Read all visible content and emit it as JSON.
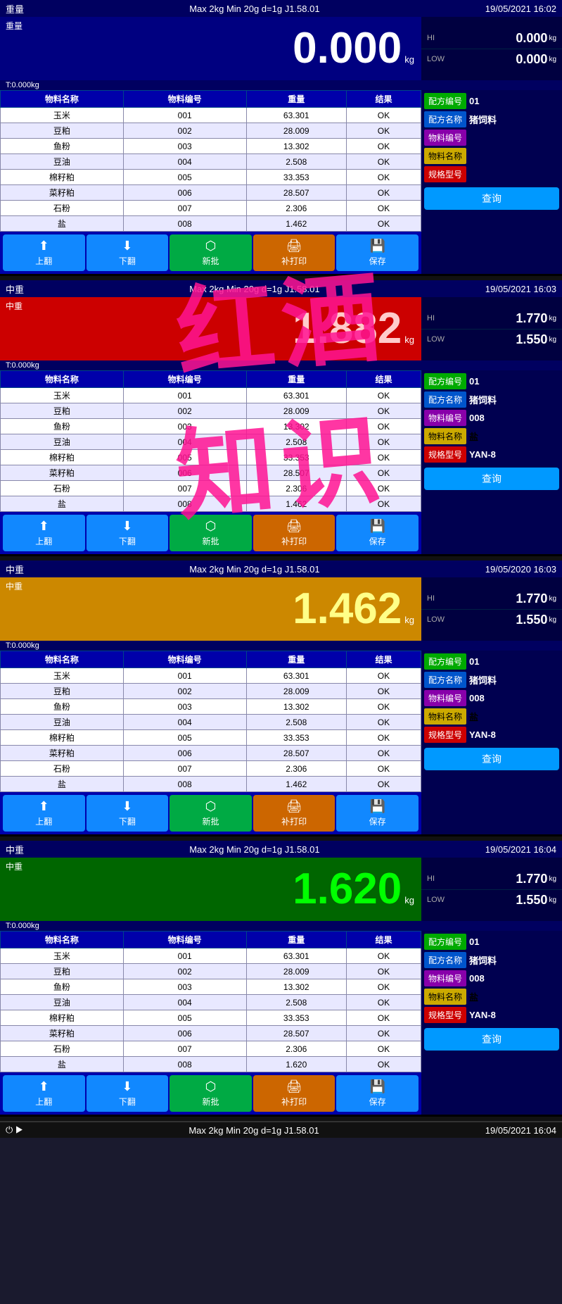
{
  "app": {
    "title": "红酒知识"
  },
  "panels": [
    {
      "id": "panel1",
      "topbar": {
        "left": "重量",
        "center": "Max 2kg  Min 20g  d=1g    J1.58.01",
        "right": "19/05/2021  16:02"
      },
      "weight": {
        "value": "0.000",
        "color": "white",
        "unit": "kg",
        "hi": "0.000",
        "lo": "0.000"
      },
      "sublabel": "T:0.000kg",
      "table": {
        "headers": [
          "物料名称",
          "物料编号",
          "重量",
          "结果"
        ],
        "rows": [
          [
            "玉米",
            "001",
            "63.301",
            "OK"
          ],
          [
            "豆粕",
            "002",
            "28.009",
            "OK"
          ],
          [
            "鱼粉",
            "003",
            "13.302",
            "OK"
          ],
          [
            "豆油",
            "004",
            "2.508",
            "OK"
          ],
          [
            "棉籽粕",
            "005",
            "33.353",
            "OK"
          ],
          [
            "菜籽粕",
            "006",
            "28.507",
            "OK"
          ],
          [
            "石粉",
            "007",
            "2.306",
            "OK"
          ],
          [
            "盐",
            "008",
            "1.462",
            "OK"
          ]
        ]
      },
      "info": {
        "formula_no_label": "配方编号",
        "formula_no_value": "01",
        "formula_name_label": "配方名称",
        "formula_name_value": "猪饲料",
        "material_no_label": "物料编号",
        "material_no_value": "",
        "material_name_label": "物料名称",
        "material_name_value": "",
        "spec_label": "规格型号",
        "spec_value": "",
        "query_btn": "查询"
      },
      "buttons": [
        "上翻",
        "下翻",
        "新批",
        "补打印",
        "保存"
      ]
    },
    {
      "id": "panel2",
      "topbar": {
        "left": "中重",
        "center": "Max 2kg  Min 20g  d=1g    J1.58.01",
        "right": "19/05/2021  16:03"
      },
      "weight": {
        "value": "1.882",
        "color": "red",
        "unit": "kg",
        "hi": "1.770",
        "lo": "1.550"
      },
      "sublabel": "T:0.000kg",
      "table": {
        "headers": [
          "物料名称",
          "物料编号",
          "重量",
          "结果"
        ],
        "rows": [
          [
            "玉米",
            "001",
            "63.301",
            "OK"
          ],
          [
            "豆粕",
            "002",
            "28.009",
            "OK"
          ],
          [
            "鱼粉",
            "003",
            "13.302",
            "OK"
          ],
          [
            "豆油",
            "004",
            "2.508",
            "OK"
          ],
          [
            "棉籽粕",
            "005",
            "33.353",
            "OK"
          ],
          [
            "菜籽粕",
            "006",
            "28.507",
            "OK"
          ],
          [
            "石粉",
            "007",
            "2.306",
            "OK"
          ],
          [
            "盐",
            "008",
            "1.462",
            "OK"
          ]
        ]
      },
      "info": {
        "formula_no_label": "配方编号",
        "formula_no_value": "01",
        "formula_name_label": "配方名称",
        "formula_name_value": "猪饲料",
        "material_no_label": "物料编号",
        "material_no_value": "008",
        "material_name_label": "物料名称",
        "material_name_value": "盐",
        "spec_label": "规格型号",
        "spec_value": "YAN-8",
        "query_btn": "查询"
      },
      "buttons": [
        "上翻",
        "下翻",
        "新批",
        "补打印",
        "保存"
      ]
    },
    {
      "id": "panel3",
      "topbar": {
        "left": "中重",
        "center": "Max 2kg  Min 20g  d=1g    J1.58.01",
        "right": "19/05/2020  16:03"
      },
      "weight": {
        "value": "1.462",
        "color": "yellow",
        "unit": "kg",
        "hi": "1.770",
        "lo": "1.550"
      },
      "sublabel": "T:0.000kg",
      "table": {
        "headers": [
          "物料名称",
          "物料编号",
          "重量",
          "结果"
        ],
        "rows": [
          [
            "玉米",
            "001",
            "63.301",
            "OK"
          ],
          [
            "豆粕",
            "002",
            "28.009",
            "OK"
          ],
          [
            "鱼粉",
            "003",
            "13.302",
            "OK"
          ],
          [
            "豆油",
            "004",
            "2.508",
            "OK"
          ],
          [
            "棉籽粕",
            "005",
            "33.353",
            "OK"
          ],
          [
            "菜籽粕",
            "006",
            "28.507",
            "OK"
          ],
          [
            "石粉",
            "007",
            "2.306",
            "OK"
          ],
          [
            "盐",
            "008",
            "1.462",
            "OK"
          ]
        ]
      },
      "info": {
        "formula_no_label": "配方编号",
        "formula_no_value": "01",
        "formula_name_label": "配方名称",
        "formula_name_value": "猪饲料",
        "material_no_label": "物料编号",
        "material_no_value": "008",
        "material_name_label": "物料名称",
        "material_name_value": "盐",
        "spec_label": "规格型号",
        "spec_value": "YAN-8",
        "query_btn": "查询"
      },
      "buttons": [
        "上翻",
        "下翻",
        "新批",
        "补打印",
        "保存"
      ]
    },
    {
      "id": "panel4",
      "topbar": {
        "left": "中重",
        "center": "Max 2kg  Min 20g  d=1g    J1.58.01",
        "right": "19/05/2021  16:04"
      },
      "weight": {
        "value": "1.620",
        "color": "green",
        "unit": "kg",
        "hi": "1.770",
        "lo": "1.550"
      },
      "sublabel": "T:0.000kg",
      "table": {
        "headers": [
          "物料名称",
          "物料编号",
          "重量",
          "结果"
        ],
        "rows": [
          [
            "玉米",
            "001",
            "63.301",
            "OK"
          ],
          [
            "豆粕",
            "002",
            "28.009",
            "OK"
          ],
          [
            "鱼粉",
            "003",
            "13.302",
            "OK"
          ],
          [
            "豆油",
            "004",
            "2.508",
            "OK"
          ],
          [
            "棉籽粕",
            "005",
            "33.353",
            "OK"
          ],
          [
            "菜籽粕",
            "006",
            "28.507",
            "OK"
          ],
          [
            "石粉",
            "007",
            "2.306",
            "OK"
          ],
          [
            "盐",
            "008",
            "1.620",
            "OK"
          ]
        ]
      },
      "info": {
        "formula_no_label": "配方编号",
        "formula_no_value": "01",
        "formula_name_label": "配方名称",
        "formula_name_value": "猪饲料",
        "material_no_label": "物料编号",
        "material_no_value": "008",
        "material_name_label": "物料名称",
        "material_name_value": "盐",
        "spec_label": "规格型号",
        "spec_value": "YAN-8",
        "query_btn": "查询"
      },
      "buttons": [
        "上翻",
        "下翻",
        "新批",
        "补打印",
        "保存"
      ]
    }
  ],
  "bottom_bar": {
    "left": "⏻ ▶",
    "center": "Max 2kg  Min 20g  d=1g    J1.58.01",
    "right": "19/05/2021  16:04"
  },
  "watermark": {
    "line1": "红酒",
    "line2": "知识"
  },
  "icons": {
    "up": "⬆",
    "down": "⬇",
    "batch": "⬡",
    "reprint": "🖨",
    "save": "💾"
  }
}
